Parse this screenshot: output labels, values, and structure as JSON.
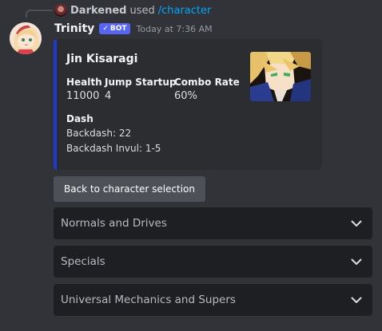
{
  "reply": {
    "username": "Darkened",
    "used_text": "used",
    "command": "/character"
  },
  "message": {
    "author": "Trinity",
    "bot_badge": "BOT",
    "timestamp": "Today at 7:36 AM"
  },
  "embed": {
    "accent_color": "#1f3bcf",
    "title": "Jin Kisaragi",
    "fields": {
      "health": {
        "name": "Health",
        "value": "11000"
      },
      "jump_startup": {
        "name": "Jump Startup",
        "value": "4"
      },
      "combo_rate": {
        "name": "Combo Rate",
        "value": "60%"
      },
      "dash": {
        "name": "Dash",
        "backdash": "Backdash: 22",
        "backdash_invul": "Backdash Invul: 1-5"
      }
    }
  },
  "buttons": {
    "back": "Back to character selection"
  },
  "selects": [
    {
      "label": "Normals and Drives"
    },
    {
      "label": "Specials"
    },
    {
      "label": "Universal Mechanics and Supers"
    }
  ],
  "icons": {
    "verified": "check-icon",
    "select": "chevron-down-icon"
  }
}
